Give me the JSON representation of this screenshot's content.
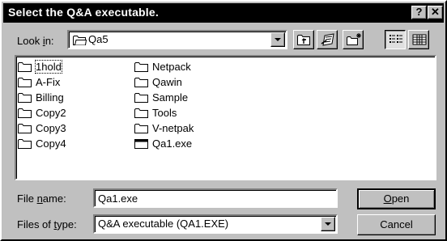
{
  "window": {
    "title": "Select the Q&A executable.",
    "help_label": "?",
    "close_label": "✕"
  },
  "look_in": {
    "label_pre": "Look ",
    "label_key": "i",
    "label_post": "n:",
    "value": "Qa5"
  },
  "toolbar": {
    "icons": [
      "up-one-level-icon",
      "desktop-icon",
      "new-folder-icon",
      "list-view-icon",
      "details-view-icon"
    ],
    "active_view": "list-view-icon"
  },
  "files": [
    {
      "name": "1hold",
      "type": "folder"
    },
    {
      "name": "A-Fix",
      "type": "folder"
    },
    {
      "name": "Billing",
      "type": "folder"
    },
    {
      "name": "Copy2",
      "type": "folder"
    },
    {
      "name": "Copy3",
      "type": "folder"
    },
    {
      "name": "Copy4",
      "type": "folder"
    },
    {
      "name": "Netpack",
      "type": "folder"
    },
    {
      "name": "Qawin",
      "type": "folder"
    },
    {
      "name": "Sample",
      "type": "folder"
    },
    {
      "name": "Tools",
      "type": "folder"
    },
    {
      "name": "V-netpak",
      "type": "folder"
    },
    {
      "name": "Qa1.exe",
      "type": "executable"
    }
  ],
  "file_name": {
    "label_pre": "File ",
    "label_key": "n",
    "label_post": "ame:",
    "value": "Qa1.exe"
  },
  "file_type": {
    "label_pre": "Files of ",
    "label_key": "t",
    "label_post": "ype:",
    "value": "Q&A executable (QA1.EXE)"
  },
  "buttons": {
    "open_key": "O",
    "open_rest": "pen",
    "cancel_label": "Cancel"
  }
}
